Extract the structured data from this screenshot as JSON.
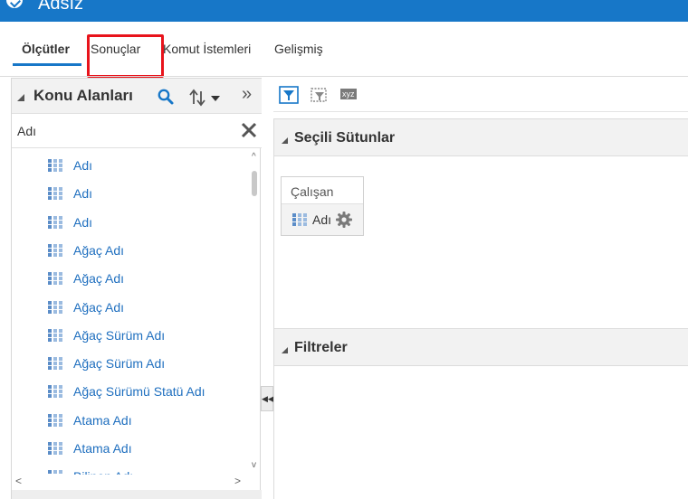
{
  "window": {
    "title": "Adsız"
  },
  "tabs": [
    {
      "label": "Ölçütler",
      "active": true
    },
    {
      "label": "Sonuçlar",
      "active": false
    },
    {
      "label": "Komut İstemleri",
      "active": false
    },
    {
      "label": "Gelişmiş",
      "active": false
    }
  ],
  "subject_areas": {
    "title": "Konu Alanları",
    "search_value": "Adı",
    "items": [
      {
        "label": "Adı"
      },
      {
        "label": "Adı"
      },
      {
        "label": "Adı"
      },
      {
        "label": "Ağaç Adı"
      },
      {
        "label": "Ağaç Adı"
      },
      {
        "label": "Ağaç Adı"
      },
      {
        "label": "Ağaç Sürüm Adı"
      },
      {
        "label": "Ağaç Sürüm Adı"
      },
      {
        "label": "Ağaç Sürümü Statü Adı"
      },
      {
        "label": "Atama Adı"
      },
      {
        "label": "Atama Adı"
      },
      {
        "label": "Bilinen Adı"
      }
    ]
  },
  "toolbar": {
    "xyz_label": "xyz"
  },
  "selected_columns": {
    "title": "Seçili Sütunlar",
    "group": "Çalışan",
    "column": "Adı"
  },
  "filters": {
    "title": "Filtreler"
  },
  "colors": {
    "brand": "#1777c8",
    "highlight": "#e8131b",
    "link": "#1f6fbf"
  }
}
